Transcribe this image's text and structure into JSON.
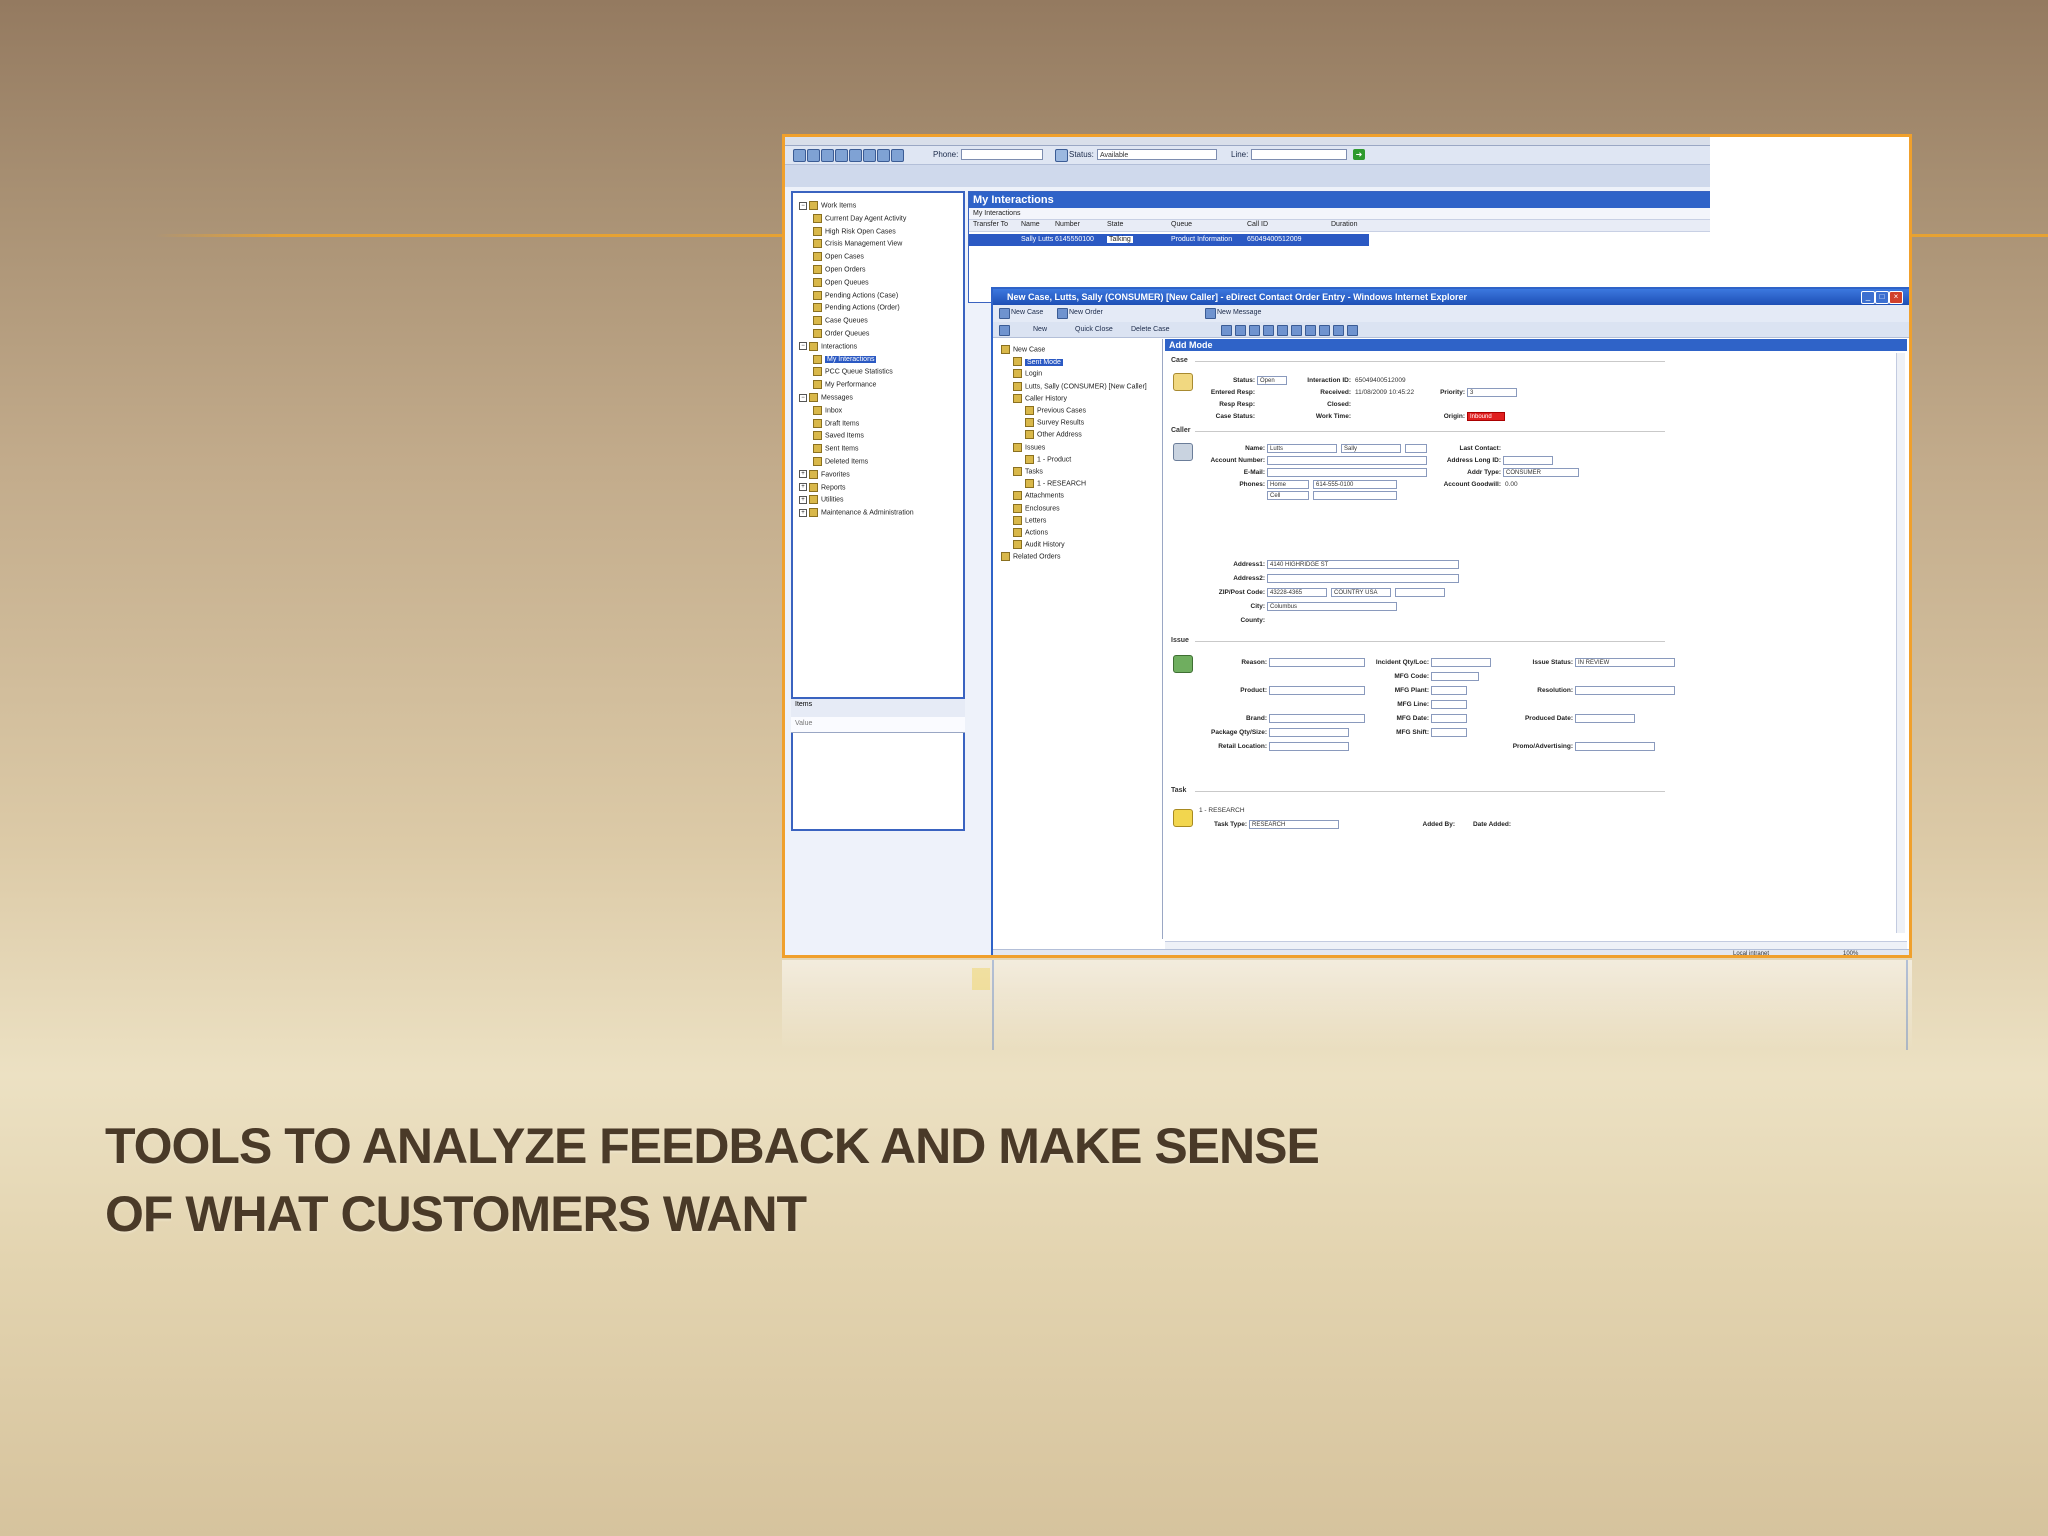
{
  "slide": {
    "title_line1": "TOOLS TO ANALYZE FEEDBACK AND MAKE SENSE",
    "title_line2": "OF WHAT CUSTOMERS WANT",
    "accent_color": "#e6a233",
    "title_color": "#4a3a28"
  },
  "back_window": {
    "toolbar": {
      "phone_label": "Phone:",
      "status_label": "Status:",
      "status_value": "Available",
      "line_label": "Line:"
    },
    "tree": [
      "Work Items",
      "Current Day Agent Activity",
      "High Risk Open Cases",
      "Crisis Management View",
      "Open Cases",
      "Open Orders",
      "Open Queues",
      "Pending Actions (Case)",
      "Pending Actions (Order)",
      "Case Queues",
      "Order Queues",
      "Interactions",
      "My Interactions",
      "PCC Queue Statistics",
      "My Performance",
      "Messages",
      "Inbox",
      "Draft Items",
      "Saved Items",
      "Sent Items",
      "Deleted Items",
      "Favorites",
      "Reports",
      "Utilities",
      "Maintenance & Administration"
    ],
    "props_label": "Items",
    "props_value": "Value",
    "interactions": {
      "title": "My Interactions",
      "subtitle": "My Interactions",
      "columns": [
        "Transfer To",
        "Name",
        "Number",
        "State",
        "Queue",
        "Call ID",
        "Duration"
      ],
      "row": [
        "",
        "Sally Lutts",
        "6145550100",
        "Talking",
        "Product Information",
        "65049400512009",
        ""
      ]
    }
  },
  "front_window": {
    "title": "New Case, Lutts, Sally (CONSUMER) [New Caller] - eDirect Contact Order Entry - Windows Internet Explorer",
    "toolbar1": [
      "New Case",
      "New Order",
      "New Message"
    ],
    "toolbar2": [
      "New",
      "Quick Close",
      "Delete Case"
    ],
    "case_tree": [
      "New Case",
      "Sent Mode",
      "Login",
      "Lutts, Sally (CONSUMER) [New Caller]",
      "Caller History",
      "Previous Cases",
      "Survey Results",
      "Other Address",
      "Issues",
      "1 - Product",
      "Tasks",
      "1 - RESEARCH",
      "Attachments",
      "Enclosures",
      "Letters",
      "Actions",
      "Audit History",
      "Related Orders"
    ],
    "form_title": "Add Mode",
    "sections": {
      "case": "Case",
      "caller": "Caller",
      "issue": "Issue",
      "task": "Task"
    },
    "case_fields": {
      "status_label": "Status:",
      "status_value": "Open",
      "interaction_label": "Interaction ID:",
      "interaction_value": "65049400512009",
      "entry_label": "Entered Resp:",
      "received_label": "Received:",
      "received_value": "11/08/2009 10:45:22",
      "priority_label": "Priority:",
      "priority_value": "3",
      "resp_label": "Resp Resp:",
      "closed_label": "Closed:",
      "case_status_label": "Case Status:",
      "work_time_label": "Work Time:",
      "origin_label": "Origin:",
      "origin_value": "Inbound"
    },
    "caller_fields": {
      "name_label": "Name:",
      "name_first": "Lutts",
      "name_last": "Sally",
      "last_contact_label": "Last Contact:",
      "account_label": "Account Number:",
      "address_long_label": "Address Long ID:",
      "email_label": "E-Mail:",
      "addr_type_label": "Addr Type:",
      "addr_type_value": "CONSUMER",
      "phones_label": "Phones:",
      "phone_type": "Home",
      "phone_value": "614-555-0100",
      "phone_type2": "Cell",
      "account_goodwill_label": "Account Goodwill:",
      "account_goodwill_value": "0.00",
      "address1_label": "Address1:",
      "address1_value": "4140 HIGHRIDGE ST",
      "address2_label": "Address2:",
      "zip_label": "ZIP/Post Code:",
      "zip_value": "43228-4365",
      "country_value": "COUNTRY USA",
      "city_label": "City:",
      "city_value": "Columbus",
      "county_label": "County:"
    },
    "issue_fields": {
      "reason_label": "Reason:",
      "incident_label": "Incident Qty/Loc:",
      "issue_status_label": "Issue Status:",
      "issue_status_value": "IN REVIEW",
      "mfg_code_label": "MFG Code:",
      "product_label": "Product:",
      "mfg_plant_label": "MFG Plant:",
      "resolution_label": "Resolution:",
      "mfg_line_label": "MFG Line:",
      "brand_label": "Brand:",
      "mfg_date_label": "MFG Date:",
      "produced_date_label": "Produced Date:",
      "package_label": "Package Qty/Size:",
      "mfg_shift_label": "MFG Shift:",
      "retail_label": "Retail Location:",
      "promo_label": "Promo/Advertising:"
    },
    "task_fields": {
      "task_item": "1 - RESEARCH",
      "task_type_label": "Task Type:",
      "task_type_value": "RESEARCH",
      "added_by_label": "Added By:",
      "date_added_label": "Date Added:"
    },
    "statusbar": {
      "zone": "Local intranet",
      "zoom": "100%"
    }
  }
}
